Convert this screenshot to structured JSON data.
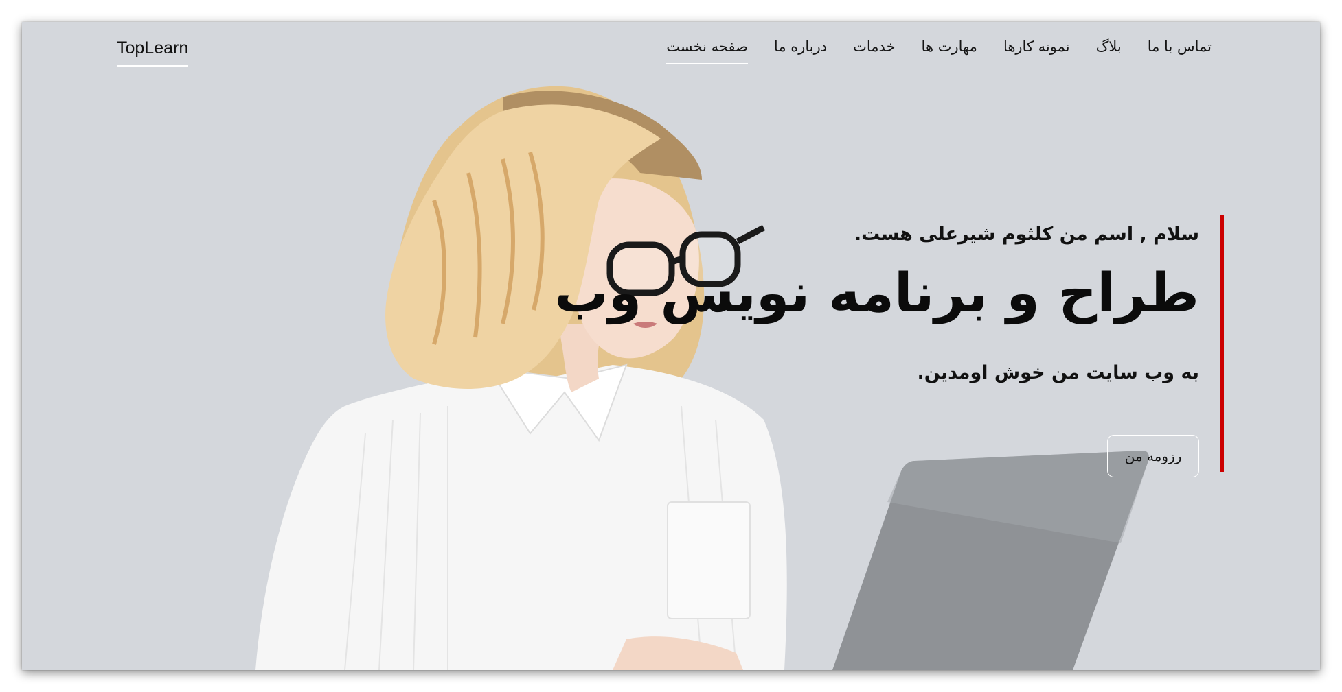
{
  "brand": {
    "name": "TopLearn"
  },
  "nav": {
    "items": [
      {
        "label": "صفحه نخست",
        "active": true
      },
      {
        "label": "درباره ما"
      },
      {
        "label": "خدمات"
      },
      {
        "label": "مهارت ها"
      },
      {
        "label": "نمونه کارها"
      },
      {
        "label": "بلاگ"
      },
      {
        "label": "تماس با ما"
      }
    ]
  },
  "hero": {
    "greeting": "سلام , اسم من کلثوم شیرعلی هست.",
    "headline": "طراح و برنامه نویس وب",
    "welcome": "به وب سایت من خوش اومدین.",
    "resume_button": "رزومه من",
    "image_subject": "woman-with-laptop-photo"
  },
  "colors": {
    "background": "#d4d7dc",
    "accent": "#cc0000",
    "text": "#111111"
  }
}
